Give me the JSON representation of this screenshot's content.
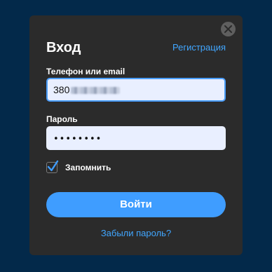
{
  "modal": {
    "title": "Вход",
    "register_link": "Регистрация",
    "close_icon": "close-icon"
  },
  "phone_field": {
    "label": "Телефон или email",
    "value_visible_prefix": "380",
    "value_obscured": true,
    "focused": true
  },
  "password_field": {
    "label": "Пароль",
    "value_masked": "••••••••"
  },
  "remember": {
    "label": "Запомнить",
    "checked": true,
    "check_icon": "checkmark-icon"
  },
  "submit": {
    "label": "Войти"
  },
  "forgot_link": "Забыли пароль?",
  "colors": {
    "background": "#03294a",
    "modal": "#2b2b2b",
    "accent": "#3f9dff",
    "link": "#41a6ff",
    "input_bg": "#e9efff"
  }
}
